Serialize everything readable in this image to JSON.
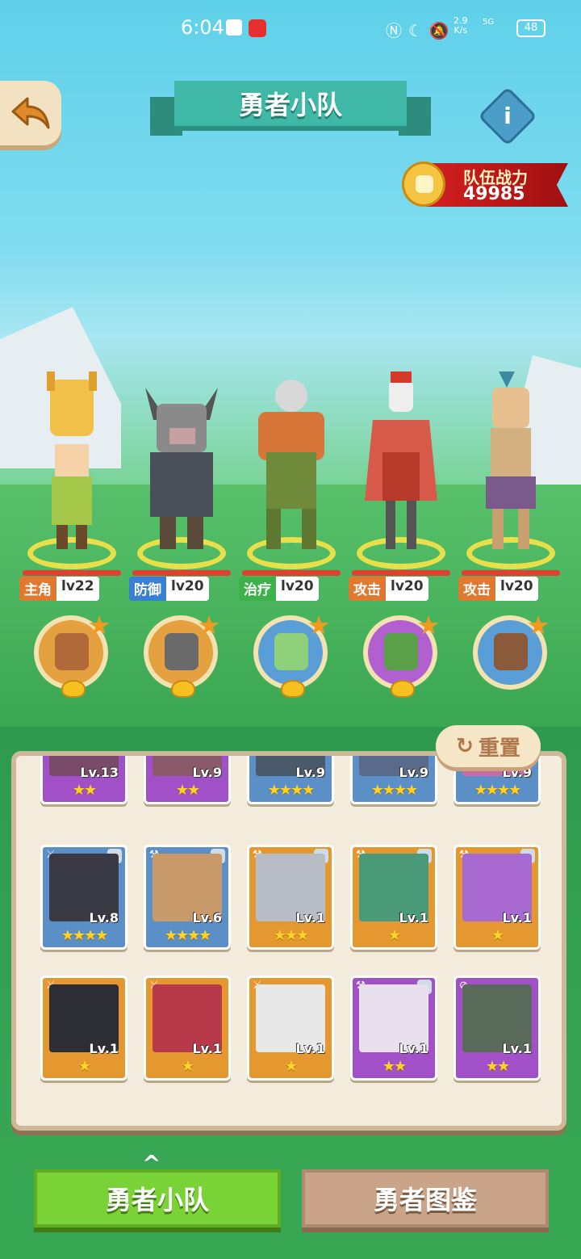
{
  "status_bar": {
    "time": "6:04",
    "speed_value": "2.9",
    "speed_unit": "K/s",
    "network": "5G",
    "battery": "48"
  },
  "header": {
    "title": "勇者小队",
    "back_icon": "back-arrow-icon",
    "info_icon": "info-icon",
    "power_label": "队伍战力",
    "power_value": "49985"
  },
  "heroes": [
    {
      "role": "主角",
      "level": "lv22",
      "role_color": "#e0782f"
    },
    {
      "role": "防御",
      "level": "lv20",
      "role_color": "#3a7fd6"
    },
    {
      "role": "治疗",
      "level": "lv20",
      "role_color": "#3db24a"
    },
    {
      "role": "攻击",
      "level": "lv20",
      "role_color": "#e0782f"
    },
    {
      "role": "攻击",
      "level": "lv20",
      "role_color": "#e0782f"
    }
  ],
  "pets": [
    {
      "name": "tree-pet",
      "bg": "#e5a040"
    },
    {
      "name": "stone-pet",
      "bg": "#e5a040"
    },
    {
      "name": "turtle-pet",
      "bg": "#5a9ed8"
    },
    {
      "name": "goblin-pet",
      "bg": "#b25fd0"
    },
    {
      "name": "boar-pet",
      "bg": "#5a9ed8"
    }
  ],
  "reset_label": "重置",
  "roster_row1": [
    {
      "level": "Lv.13",
      "stars": "★★",
      "tone": "purple"
    },
    {
      "level": "Lv.9",
      "stars": "★★",
      "tone": "purple"
    },
    {
      "level": "Lv.9",
      "stars": "★★★★",
      "tone": "blue"
    },
    {
      "level": "Lv.9",
      "stars": "★★★★",
      "tone": "blue"
    },
    {
      "level": "Lv.9",
      "stars": "★★★★",
      "tone": "blue"
    }
  ],
  "roster_row2": [
    {
      "level": "Lv.8",
      "stars": "★★★★",
      "tone": "blue"
    },
    {
      "level": "Lv.6",
      "stars": "★★★★",
      "tone": "blue"
    },
    {
      "level": "Lv.1",
      "stars": "★★★",
      "tone": "orange"
    },
    {
      "level": "Lv.1",
      "stars": "★",
      "tone": "orange"
    },
    {
      "level": "Lv.1",
      "stars": "★",
      "tone": "orange"
    }
  ],
  "roster_row3": [
    {
      "level": "Lv.1",
      "stars": "★",
      "tone": "orange"
    },
    {
      "level": "Lv.1",
      "stars": "★",
      "tone": "orange"
    },
    {
      "level": "Lv.1",
      "stars": "★",
      "tone": "orange"
    },
    {
      "level": "Lv.1",
      "stars": "★★",
      "tone": "purple"
    },
    {
      "level": "Lv.1",
      "stars": "★★",
      "tone": "purple"
    }
  ],
  "tabs": {
    "team": "勇者小队",
    "codex": "勇者图鉴"
  }
}
